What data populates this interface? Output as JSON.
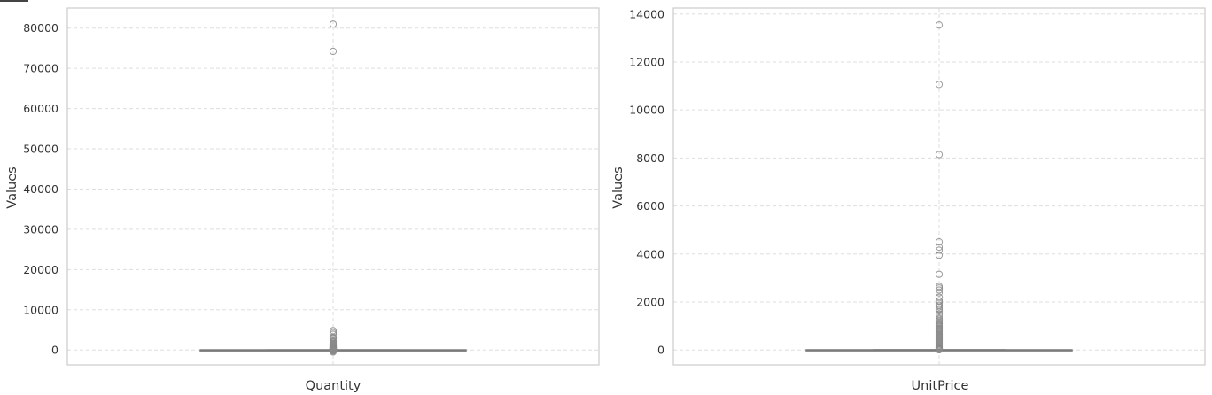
{
  "chart_data": [
    {
      "type": "box",
      "category": "Quantity",
      "xlabel": "Quantity",
      "ylabel": "Values",
      "ylim": [
        -3700,
        85000
      ],
      "yticks": [
        0,
        10000,
        20000,
        30000,
        40000,
        50000,
        60000,
        70000,
        80000
      ],
      "grid": true,
      "box": {
        "q1": 1,
        "median": 3,
        "q3": 10,
        "whisker_low": -12,
        "whisker_high": 23
      },
      "outliers": [
        80995,
        74215,
        4800,
        4300,
        3906,
        3186,
        3114,
        2880,
        2400,
        2160,
        2000,
        1930,
        1600,
        1540,
        1440,
        1412,
        1350,
        1200,
        1152,
        1056,
        1010,
        960,
        864,
        800,
        768,
        720,
        700,
        640,
        600,
        576,
        500,
        480,
        432,
        400,
        384,
        360,
        320,
        300,
        288,
        250,
        240,
        200,
        192,
        160,
        150,
        144,
        120,
        100,
        96,
        80,
        72,
        64,
        60,
        50,
        48,
        40,
        36,
        -25,
        -36,
        -48,
        -72,
        -100,
        -144,
        -200,
        -300,
        -500
      ]
    },
    {
      "type": "box",
      "category": "UnitPrice",
      "xlabel": "UnitPrice",
      "ylabel": "Values",
      "ylim": [
        -620,
        14250
      ],
      "yticks": [
        0,
        2000,
        4000,
        6000,
        8000,
        10000,
        12000,
        14000
      ],
      "grid": true,
      "box": {
        "q1": 1.25,
        "median": 2.08,
        "q3": 4.13,
        "whisker_low": 0,
        "whisker_high": 8.45
      },
      "outliers": [
        13541,
        11062,
        8142,
        4505,
        4287,
        4161,
        3949,
        3155,
        2653,
        2583,
        2500,
        2382,
        2200,
        2053,
        2033,
        1950,
        1867,
        1800,
        1715,
        1687,
        1599,
        1500,
        1402,
        1300,
        1241,
        1200,
        1136,
        1100,
        1050,
        1000,
        950,
        900,
        860,
        820,
        780,
        740,
        700,
        660,
        620,
        580,
        540,
        500,
        460,
        420,
        380,
        340,
        300,
        260,
        220,
        180,
        150,
        120,
        100,
        80,
        60,
        45,
        30,
        20,
        15,
        12,
        10
      ]
    }
  ],
  "colors": {
    "box_line": "#7a7a7a",
    "outlier": "#8a8a8a",
    "grid": "#dddddd",
    "frame": "#cccccc",
    "text": "#333333"
  }
}
